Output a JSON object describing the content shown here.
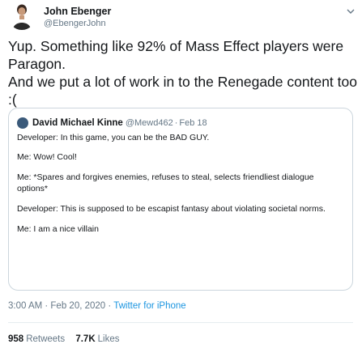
{
  "tweet": {
    "author": {
      "name": "John Ebenger",
      "handle": "@EbengerJohn",
      "avatar_icon": "avatar-icon"
    },
    "menu_icon": "chevron-down-icon",
    "text_lines": [
      "Yup. Something like 92% of Mass Effect players were Paragon.",
      "And we put a lot of work in to the Renegade content too :("
    ],
    "quote": {
      "author_name": "David Michael Kinne",
      "author_handle": "@Mewd462",
      "separator": "·",
      "date": "Feb 18",
      "lines": [
        "Developer: In this game, you can be the BAD GUY.",
        "Me: Wow! Cool!",
        "Me: *Spares and forgives enemies, refuses to steal, selects friendliest dialogue options*",
        "Developer: This is supposed to be escapist fantasy about violating societal norms.",
        "Me: I am a nice villain"
      ]
    },
    "timestamp": "3:00 AM · Feb 20, 2020 · ",
    "source": "Twitter for iPhone",
    "stats": {
      "retweets_count": "958",
      "retweets_label": "Retweets",
      "likes_count": "7.7K",
      "likes_label": "Likes"
    },
    "colors": {
      "text": "#14171a",
      "secondary": "#657786",
      "link": "#1b95e0",
      "border": "#ccd6dd"
    }
  }
}
